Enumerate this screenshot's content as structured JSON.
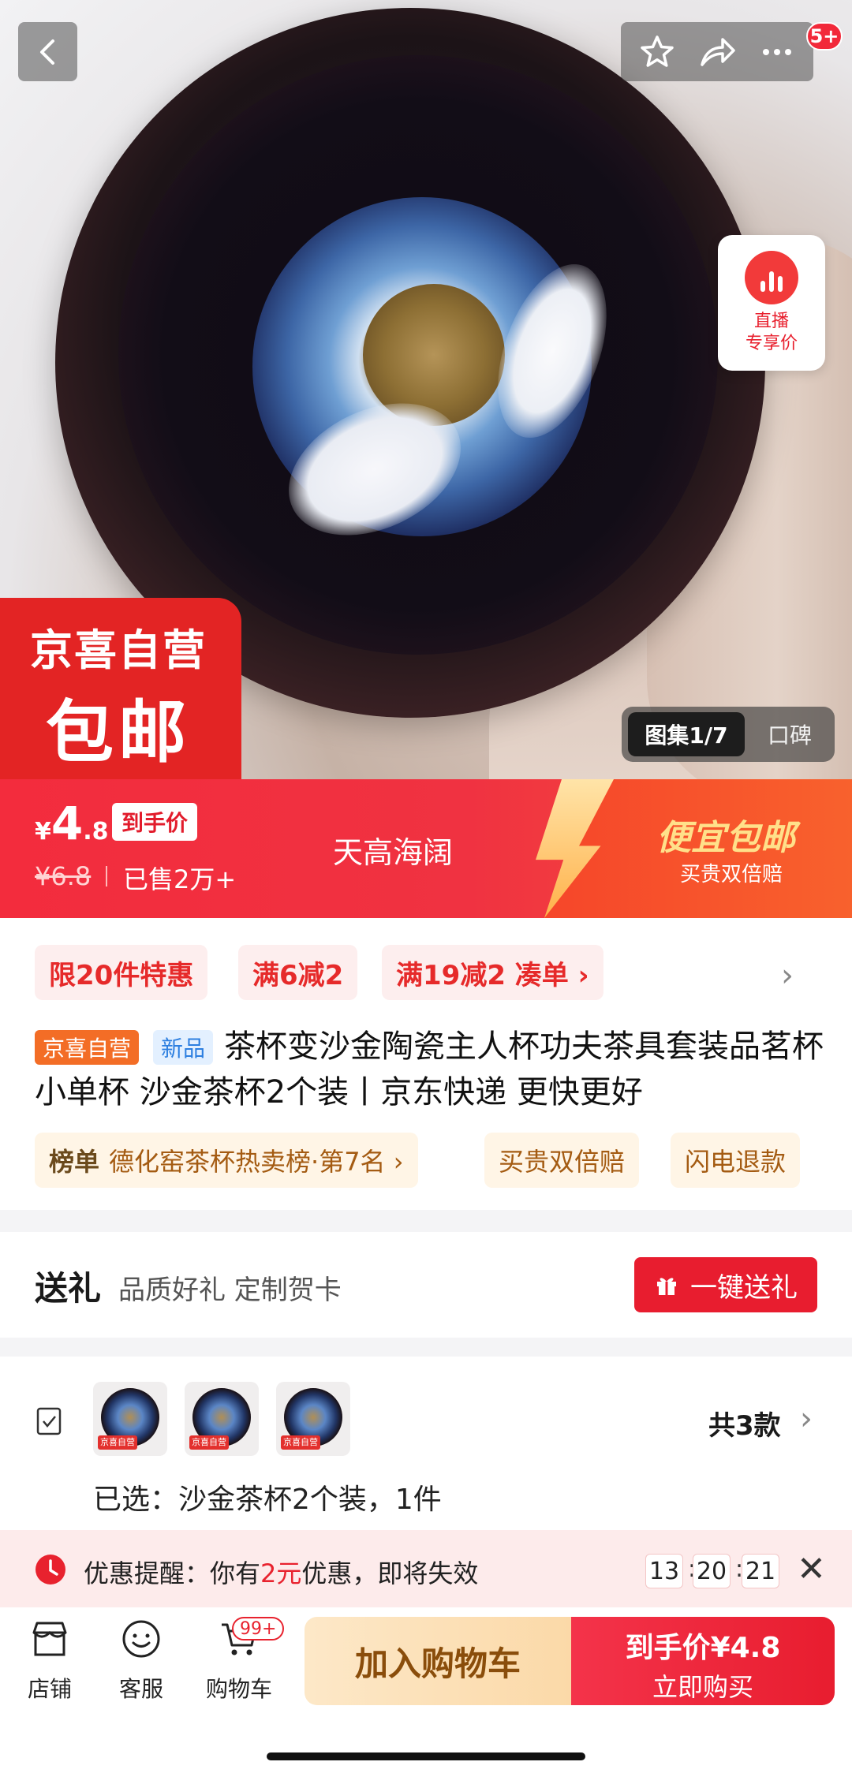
{
  "top_bar": {
    "badge": "5+"
  },
  "live_price": {
    "line1": "直播",
    "line2": "专享价"
  },
  "sticker": {
    "line1": "京喜自营",
    "line2": "包邮"
  },
  "gallery": {
    "active": "图集1/7",
    "other": "口碑"
  },
  "price": {
    "currency": "¥",
    "integer": "4",
    "decimal": ".8",
    "tag": "到手价",
    "original": "¥6.8",
    "sold": "已售2万+",
    "slogan": "天高海阔",
    "promo_title": "便宜包邮",
    "promo_sub": "买贵双倍赔"
  },
  "promos": [
    "限20件特惠",
    "满6减2",
    "满19减2  凑单 ›"
  ],
  "tags": {
    "self": "京喜自营",
    "new": "新品"
  },
  "title": "茶杯变沙金陶瓷主人杯功夫茶具套装品茗杯小单杯 沙金茶杯2个装丨京东快递 更快更好",
  "rank": {
    "label": "榜单",
    "value": "德化窑茶杯热卖榜·第7名 ›"
  },
  "service_tags": [
    "买贵双倍赔",
    "闪电退款"
  ],
  "gift": {
    "title": "送礼",
    "subtitle": "品质好礼 定制贺卡",
    "button": "一键送礼"
  },
  "variant": {
    "count": "共3款",
    "selected": "已选：沙金茶杯2个装，1件",
    "thumb_mark": "京喜自营"
  },
  "reminder": {
    "prefix": "优惠提醒：你有",
    "amount": "2元",
    "suffix": "优惠，即将失效",
    "hh": "13",
    "mm": "20",
    "ss": "21"
  },
  "bottom": {
    "shop": "店铺",
    "service": "客服",
    "cart": "购物车",
    "cart_badge": "99+",
    "add_cart": "加入购物车",
    "buy_l1": "到手价¥4.8",
    "buy_l2": "立即购买"
  },
  "colors": {
    "brand_red": "#e81d2f",
    "promo_gold": "#ffe08a",
    "cart_btn": "#fbd9a8"
  }
}
